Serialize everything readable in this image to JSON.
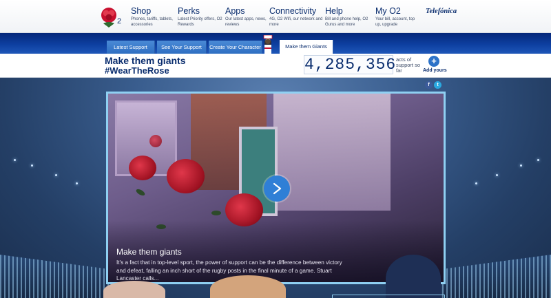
{
  "nav": {
    "logo_badge": "2",
    "items": [
      {
        "title": "Shop",
        "desc": "Phones, tariffs, tablets, accessories"
      },
      {
        "title": "Perks",
        "desc": "Latest Priority offers, O2 Rewards"
      },
      {
        "title": "Apps",
        "desc": "Our latest apps, news, reviews"
      },
      {
        "title": "Connectivity",
        "desc": "4G, O2 Wifi, our network and more"
      },
      {
        "title": "Help",
        "desc": "Bill and phone help, O2 Gurus and more"
      },
      {
        "title": "My O2",
        "desc": "Your bill, account, top up, upgrade"
      }
    ],
    "brand": "Telefónica"
  },
  "tabs": [
    {
      "label": "Latest Support"
    },
    {
      "label": "See Your Support"
    },
    {
      "label": "Create Your Character"
    },
    {
      "label": "Make them Giants"
    }
  ],
  "header": {
    "title": "Make them giants",
    "hashtag": "#WearTheRose",
    "counter": "4,285,356",
    "counter_caption": "acts of support so far",
    "add_label": "Add yours",
    "add_symbol": "+"
  },
  "share": {
    "facebook": "f",
    "twitter": "t"
  },
  "video": {
    "title": "Make them giants",
    "description": "It's a fact that in top-level sport, the power of support can be the difference between victory and defeat, falling an inch short of the rugby posts in the final minute of a game. Stuart Lancaster calls..."
  },
  "colors": {
    "navy": "#0a2d6e",
    "accent": "#2f7fd6",
    "frame": "#8fd0f2"
  }
}
